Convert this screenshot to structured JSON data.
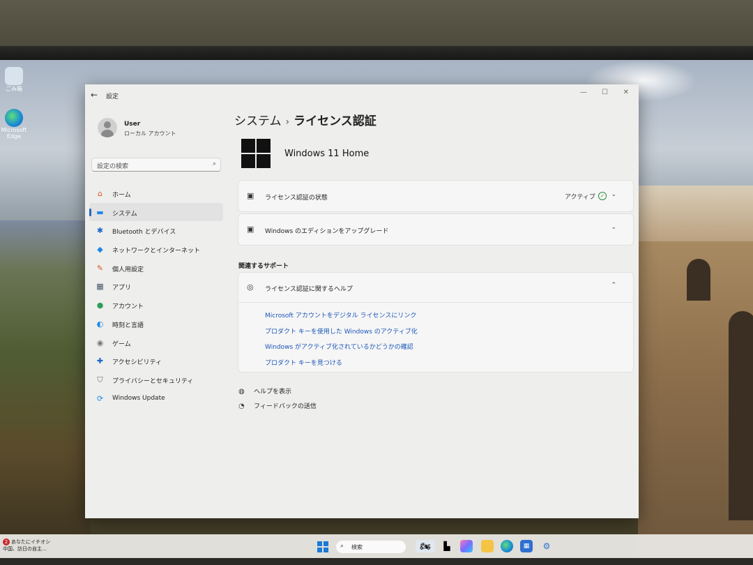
{
  "desktop": {
    "icons": [
      {
        "label": "ごみ箱",
        "icon": "recycle-bin-icon"
      },
      {
        "label": "Microsoft Edge",
        "icon": "edge-icon"
      }
    ]
  },
  "window": {
    "title": "設定",
    "controls": {
      "minimize": "—",
      "maximize": "☐",
      "close": "✕"
    }
  },
  "user": {
    "name": "User",
    "account_type": "ローカル アカウント"
  },
  "search": {
    "placeholder": "設定の検索"
  },
  "nav": [
    {
      "label": "ホーム",
      "icon": "home-icon",
      "glyph": "⌂",
      "color": "#d9531e"
    },
    {
      "label": "システム",
      "icon": "system-icon",
      "glyph": "▬",
      "color": "#1e88e5",
      "active": true
    },
    {
      "label": "Bluetooth とデバイス",
      "icon": "bluetooth-icon",
      "glyph": "✱",
      "color": "#1e66c8"
    },
    {
      "label": "ネットワークとインターネット",
      "icon": "network-icon",
      "glyph": "◆",
      "color": "#1e88e5"
    },
    {
      "label": "個人用設定",
      "icon": "brush-icon",
      "glyph": "✎",
      "color": "#d9531e"
    },
    {
      "label": "アプリ",
      "icon": "apps-icon",
      "glyph": "▦",
      "color": "#445566"
    },
    {
      "label": "アカウント",
      "icon": "account-icon",
      "glyph": "●",
      "color": "#2e9e5a"
    },
    {
      "label": "時刻と言語",
      "icon": "globe-clock-icon",
      "glyph": "◐",
      "color": "#1e88e5"
    },
    {
      "label": "ゲーム",
      "icon": "gamepad-icon",
      "glyph": "◉",
      "color": "#777777"
    },
    {
      "label": "アクセシビリティ",
      "icon": "accessibility-icon",
      "glyph": "✚",
      "color": "#1e66c8"
    },
    {
      "label": "プライバシーとセキュリティ",
      "icon": "shield-icon",
      "glyph": "⛉",
      "color": "#666666"
    },
    {
      "label": "Windows Update",
      "icon": "update-icon",
      "glyph": "⟳",
      "color": "#1e88e5"
    }
  ],
  "breadcrumb": {
    "parent": "システム",
    "separator": "›",
    "current": "ライセンス認証"
  },
  "edition": {
    "name": "Windows 11 Home"
  },
  "cards": {
    "activation_state": {
      "label": "ライセンス認証の状態",
      "status": "アクティブ",
      "icon": "license-icon"
    },
    "upgrade": {
      "label": "Windows のエディションをアップグレード",
      "icon": "license-icon"
    }
  },
  "related": {
    "heading": "関連するサポート",
    "help_card": {
      "label": "ライセンス認証に関するヘルプ",
      "icon": "globe-icon"
    },
    "links": [
      "Microsoft アカウントをデジタル ライセンスにリンク",
      "プロダクト キーを使用した Windows のアクティブ化",
      "Windows がアクティブ化されているかどうかの確認",
      "プロダクト キーを見つける"
    ]
  },
  "footer_links": {
    "help": {
      "label": "ヘルプを表示",
      "icon": "help-icon"
    },
    "feedback": {
      "label": "フィードバックの送信",
      "icon": "feedback-icon"
    }
  },
  "taskbar": {
    "news_badge": "2",
    "news_title": "あなたにイチオシ",
    "news_sub": "中国、訪日の自主...",
    "search_label": "検索",
    "apps": [
      "jetski-app-icon",
      "task-view-icon",
      "copilot-icon",
      "file-explorer-icon",
      "edge-icon",
      "store-icon",
      "settings-icon"
    ]
  }
}
